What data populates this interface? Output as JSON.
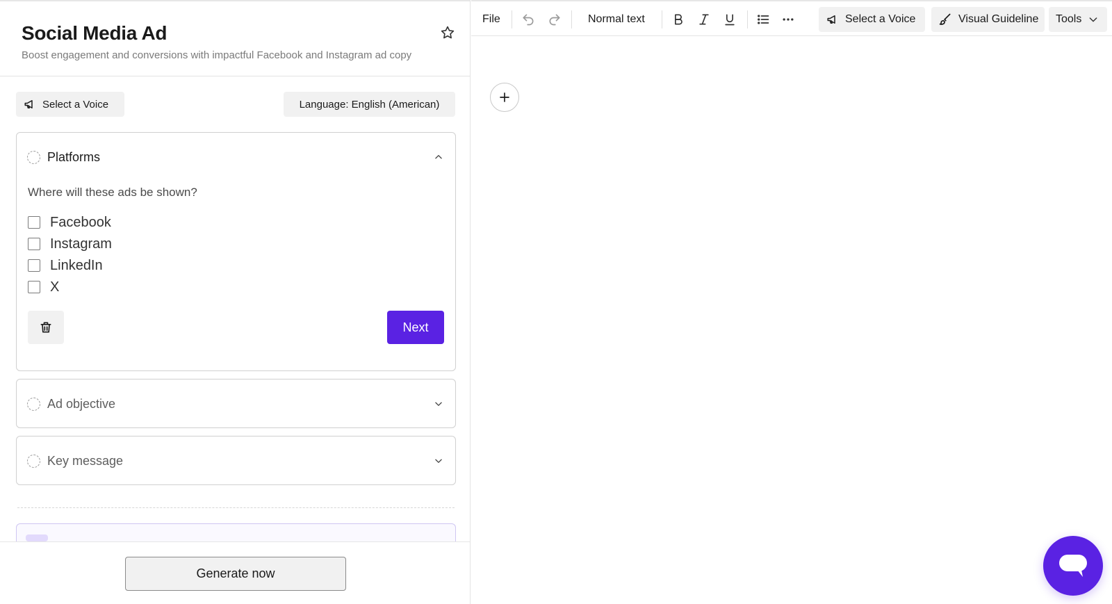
{
  "header": {
    "title": "Social Media Ad",
    "subtitle": "Boost engagement and conversions with impactful Facebook and Instagram ad copy"
  },
  "controls": {
    "voice_label": "Select a Voice",
    "language_label": "Language: English (American)"
  },
  "platforms_card": {
    "title": "Platforms",
    "question": "Where will these ads be shown?",
    "options": [
      {
        "label": "Facebook",
        "checked": false
      },
      {
        "label": "Instagram",
        "checked": false
      },
      {
        "label": "LinkedIn",
        "checked": false
      },
      {
        "label": "X",
        "checked": false
      }
    ],
    "next_label": "Next"
  },
  "collapsed_cards": [
    {
      "title": "Ad objective"
    },
    {
      "title": "Key message"
    }
  ],
  "footer": {
    "generate_label": "Generate now"
  },
  "toolbar": {
    "file_label": "File",
    "style_label": "Normal text",
    "voice_label": "Select a Voice",
    "guideline_label": "Visual Guideline",
    "tools_label": "Tools"
  },
  "colors": {
    "accent": "#5a22e3",
    "border": "#d0d0d0",
    "pill_bg": "#f1f1f1"
  },
  "icons": [
    "star-icon",
    "megaphone-icon",
    "chevron-up-icon",
    "chevron-down-icon",
    "trash-icon",
    "undo-icon",
    "redo-icon",
    "bold-icon",
    "italic-icon",
    "underline-icon",
    "bullet-list-icon",
    "more-icon",
    "brush-icon",
    "plus-icon",
    "chat-icon"
  ]
}
